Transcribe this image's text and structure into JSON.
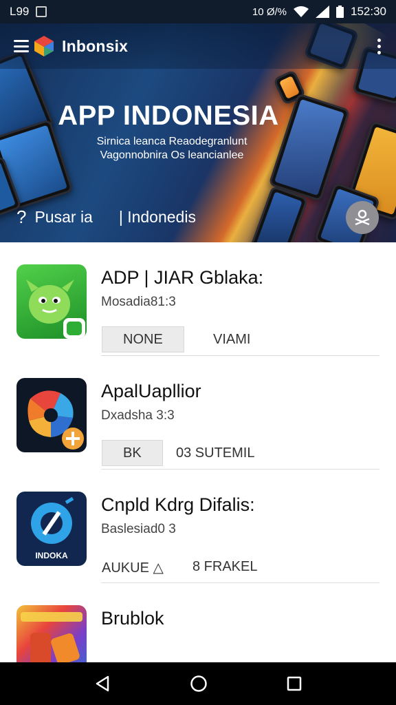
{
  "status_bar": {
    "left_text": "L99",
    "right_text": "152:30",
    "right_glyph_text": "10 Ø/%"
  },
  "header": {
    "brand": "Inbonsix"
  },
  "hero": {
    "title": "APP INDONESIA",
    "subtitle_line1": "Sirnica leanca Reaodegranlunt",
    "subtitle_line2": "Vagonnobnira Os leancianlee",
    "link_left": "Pusar ia",
    "link_right": "| Indonedis"
  },
  "apps": [
    {
      "title": "ADP | JIAR Gblaka:",
      "subtitle": "Mosadia81:3",
      "button": "NONE",
      "action": "VIAMI"
    },
    {
      "title": "ApalUapllior",
      "subtitle": "Dxadsha 3:3",
      "button": "BK",
      "action": "03 SUTEMIL"
    },
    {
      "title": "Cnpld Kdrg Difalis:",
      "subtitle": "Baslesiad0 3",
      "button": "",
      "action_left": "AUKUE △",
      "action": "8 FRAKEL",
      "icon_label": "INDOKA"
    },
    {
      "title": "Brublok",
      "subtitle": "",
      "button": "",
      "action": ""
    }
  ],
  "colors": {
    "hero_blue": "#1c4a80",
    "accent_orange": "#ff8a1e",
    "navbar": "#000000"
  },
  "icons": [
    "menu-icon",
    "app-logo-icon",
    "more-vert-icon",
    "profile-icon",
    "back-icon",
    "home-icon",
    "recents-icon",
    "wifi-icon",
    "signal-icon",
    "battery-icon"
  ]
}
